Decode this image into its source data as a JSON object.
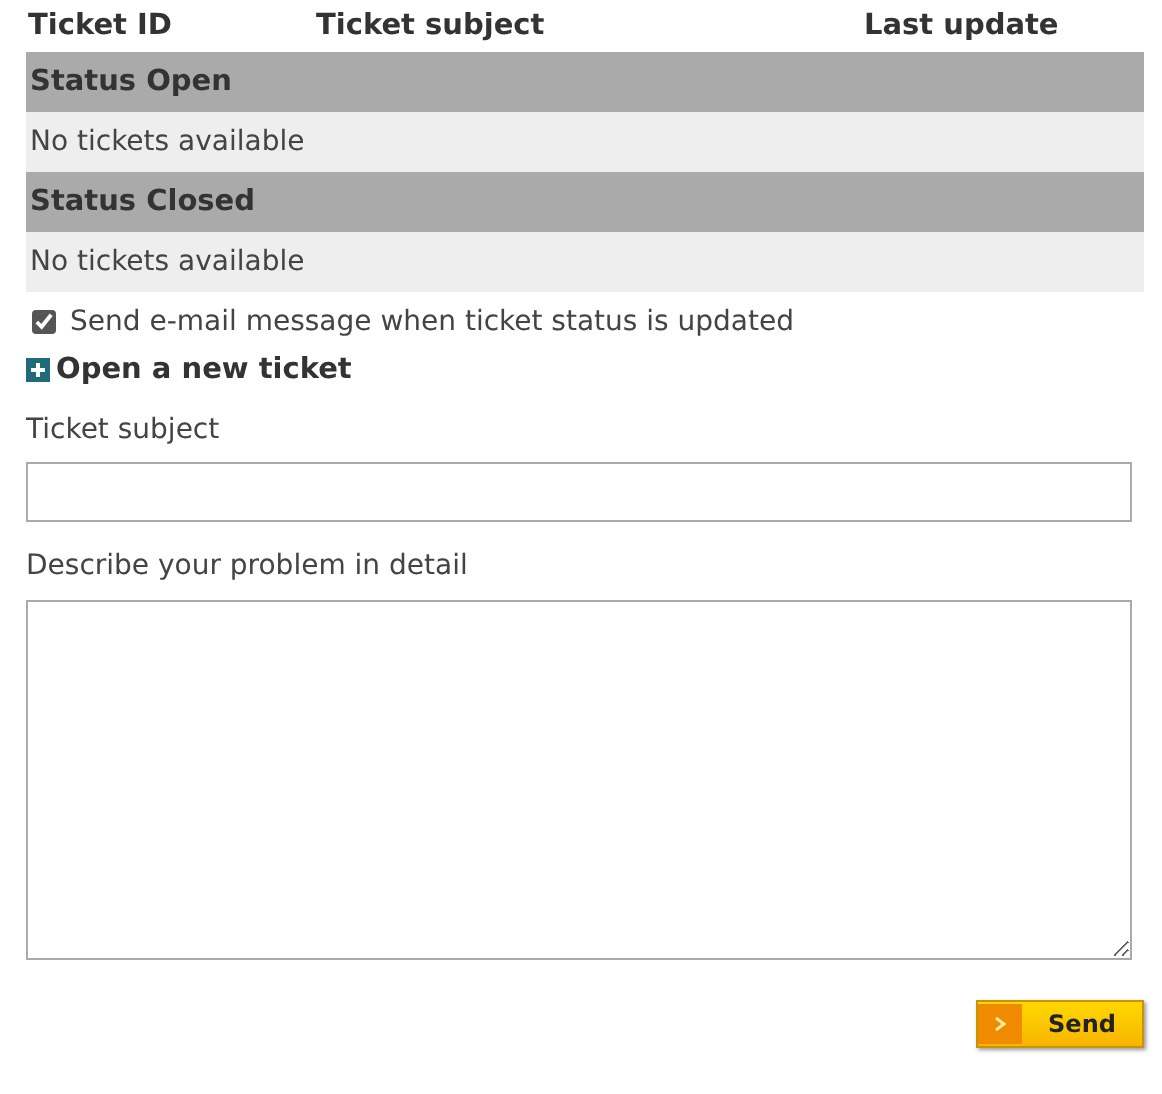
{
  "table": {
    "columns": [
      "Ticket ID",
      "Ticket subject",
      "Last update"
    ],
    "groups": [
      {
        "title": "Status Open",
        "empty_text": "No tickets available"
      },
      {
        "title": "Status Closed",
        "empty_text": "No tickets available"
      }
    ]
  },
  "notify": {
    "label": "Send e-mail message when ticket status is updated",
    "checked": true
  },
  "new_ticket": {
    "title": "Open a new ticket",
    "subject_label": "Ticket subject",
    "detail_label": "Describe your problem in detail",
    "button": "Send"
  }
}
